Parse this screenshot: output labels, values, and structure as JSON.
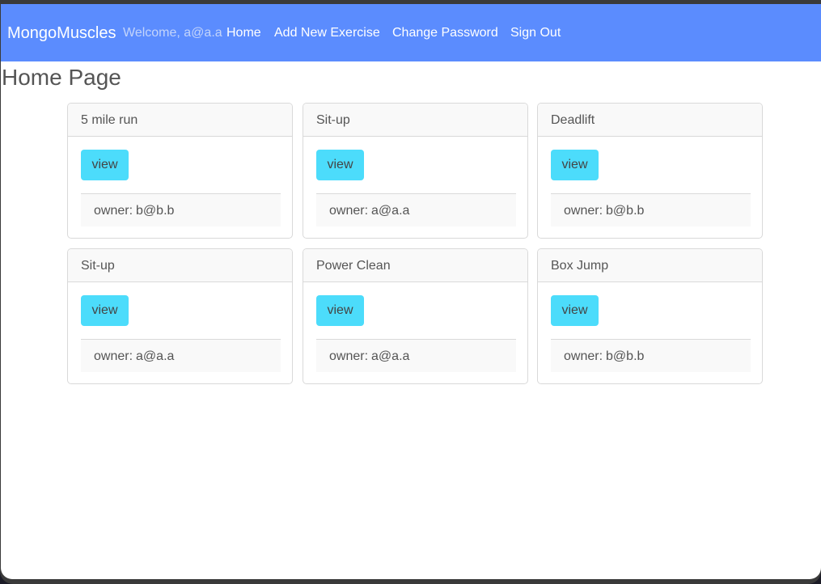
{
  "navbar": {
    "brand": "MongoMuscles",
    "welcome": "Welcome, a@a.a",
    "links": [
      {
        "label": "Home"
      },
      {
        "label": "Add New Exercise"
      },
      {
        "label": "Change Password"
      },
      {
        "label": "Sign Out"
      }
    ],
    "background_color": "#5b8cfe"
  },
  "page_title": "Home Page",
  "owner_prefix": "owner:",
  "view_label": "view",
  "view_button_color": "#4cdcfb",
  "exercises": [
    {
      "name": "5 mile run",
      "owner": "b@b.b"
    },
    {
      "name": "Sit-up",
      "owner": "a@a.a"
    },
    {
      "name": "Deadlift",
      "owner": "b@b.b"
    },
    {
      "name": "Sit-up",
      "owner": "a@a.a"
    },
    {
      "name": "Power Clean",
      "owner": "a@a.a"
    },
    {
      "name": "Box Jump",
      "owner": "b@b.b"
    }
  ]
}
